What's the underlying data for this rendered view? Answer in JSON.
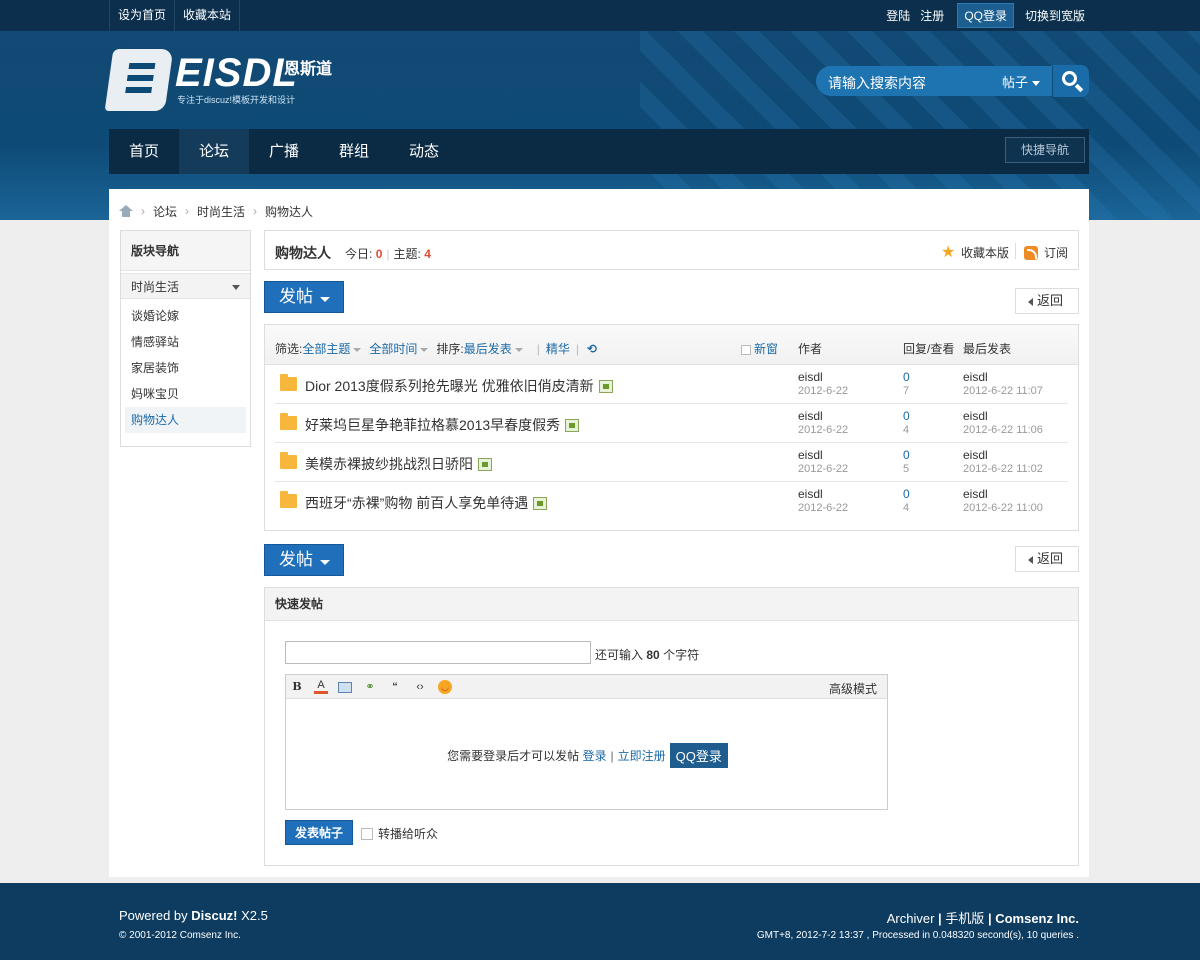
{
  "topbar": {
    "set_home": "设为首页",
    "bookmark": "收藏本站",
    "login": "登陆",
    "register": "注册",
    "qq_login": "QQ登录",
    "wide": "切换到宽版"
  },
  "logo": {
    "name": "EISDL",
    "cn": "恩斯道",
    "sub": "专注于discuz!模板开发和设计"
  },
  "search": {
    "placeholder": "请输入搜索内容",
    "type": "帖子"
  },
  "nav": {
    "items": [
      "首页",
      "论坛",
      "广播",
      "群组",
      "动态"
    ],
    "active": "论坛",
    "quick": "快捷导航"
  },
  "breadcrumb": [
    "论坛",
    "时尚生活",
    "购物达人"
  ],
  "sidebar": {
    "title": "版块导航",
    "group": "时尚生活",
    "items": [
      "谈婚论嫁",
      "情感驿站",
      "家居装饰",
      "妈咪宝贝",
      "购物达人"
    ],
    "current": "购物达人"
  },
  "forum": {
    "name": "购物达人",
    "today_label": "今日:",
    "today": "0",
    "threads_label": "主题:",
    "threads": "4",
    "fav": "收藏本版",
    "rss": "订阅"
  },
  "buttons": {
    "post": "发帖",
    "back": "返回"
  },
  "filter": {
    "label": "筛选:",
    "all_threads": "全部主题",
    "all_time": "全部时间",
    "sort_label": "排序:",
    "sort": "最后发表",
    "digest": "精华",
    "refresh": "⟲",
    "newwin": "新窗",
    "col_author": "作者",
    "col_reply": "回复/查看",
    "col_last": "最后发表"
  },
  "threads": [
    {
      "title": "Dior 2013度假系列抢先曝光 优雅依旧俏皮清新",
      "author": "eisdl",
      "date": "2012-6-22",
      "replies": "0",
      "views": "7",
      "last_user": "eisdl",
      "last_time": "2012-6-22 11:07"
    },
    {
      "title": "好莱坞巨星争艳菲拉格慕2013早春度假秀",
      "author": "eisdl",
      "date": "2012-6-22",
      "replies": "0",
      "views": "4",
      "last_user": "eisdl",
      "last_time": "2012-6-22 11:06"
    },
    {
      "title": "美模赤裸披纱挑战烈日骄阳",
      "author": "eisdl",
      "date": "2012-6-22",
      "replies": "0",
      "views": "5",
      "last_user": "eisdl",
      "last_time": "2012-6-22 11:02"
    },
    {
      "title": "西班牙“赤裸”购物 前百人享免单待遇",
      "author": "eisdl",
      "date": "2012-6-22",
      "replies": "0",
      "views": "4",
      "last_user": "eisdl",
      "last_time": "2012-6-22 11:00"
    }
  ],
  "quickpost": {
    "title": "快速发帖",
    "remain_pre": "还可输入",
    "remain_num": "80",
    "remain_post": "个字符",
    "advanced": "高级模式",
    "need_login": "您需要登录后才可以发帖",
    "login": "登录",
    "sep": "|",
    "register": "立即注册",
    "qq": "QQ登录",
    "submit": "发表帖子",
    "broadcast": "转播给听众",
    "toolbar_icons": [
      "bold-icon",
      "font-color-icon",
      "image-icon",
      "link-icon",
      "quote-icon",
      "code-icon",
      "smiley-icon"
    ]
  },
  "footer": {
    "powered": "Powered by",
    "brand": "Discuz!",
    "version": "X2.5",
    "copyright": "© 2001-2012 Comsenz Inc.",
    "archiver": "Archiver",
    "mobile": "手机版",
    "company": "Comsenz Inc.",
    "sep": "|",
    "stats": "GMT+8, 2012-7-2 13:37 , Processed in 0.048320 second(s), 10 queries ."
  },
  "colors": {
    "brand": "#0e4a76",
    "accent": "#1f6fba",
    "link": "#1b6aa6",
    "count": "#e24c35"
  }
}
